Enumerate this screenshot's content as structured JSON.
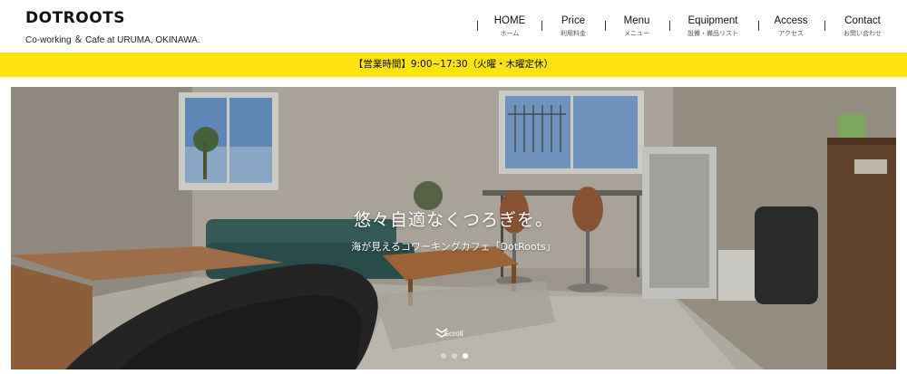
{
  "brand": {
    "logo": "DOTROOTS",
    "tagline": "Co-working ＆ Cafe at URUMA, OKINAWA."
  },
  "nav": {
    "items": [
      {
        "en": "HOME",
        "ja": "ホーム"
      },
      {
        "en": "Price",
        "ja": "利用料金"
      },
      {
        "en": "Menu",
        "ja": "メニュー"
      },
      {
        "en": "Equipment",
        "ja": "設備・備品リスト"
      },
      {
        "en": "Access",
        "ja": "アクセス"
      },
      {
        "en": "Contact",
        "ja": "お問い合わせ"
      }
    ]
  },
  "banner": {
    "hours": "【営業時間】9:00~17:30（火曜・木曜定休）",
    "color": "#ffe212"
  },
  "hero": {
    "title": "悠々自適なくつろぎを。",
    "subtitle": "海が見えるコワーキングカフェ「DotRoots」",
    "scroll_label": "Scroll",
    "scroll_icon": "double-chevron-down-icon",
    "slides": {
      "count": 3,
      "active": 3
    }
  }
}
